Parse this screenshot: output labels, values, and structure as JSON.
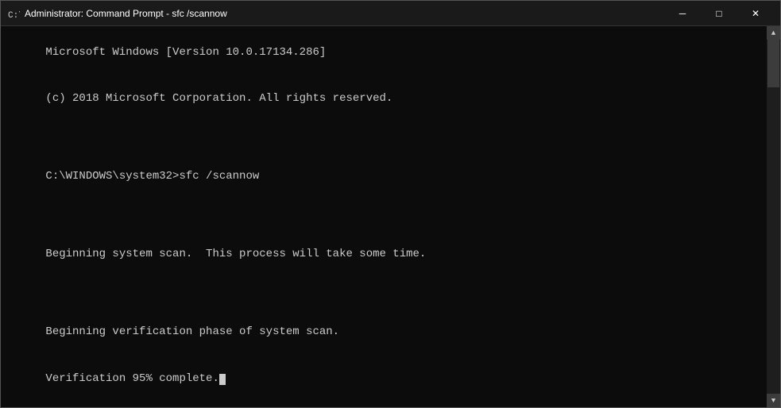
{
  "titlebar": {
    "icon_label": "cmd-icon",
    "title": "Administrator: Command Prompt - sfc /scannow",
    "minimize_label": "─",
    "maximize_label": "□",
    "close_label": "✕"
  },
  "terminal": {
    "line1": "Microsoft Windows [Version 10.0.17134.286]",
    "line2": "(c) 2018 Microsoft Corporation. All rights reserved.",
    "line3": "",
    "line4": "C:\\WINDOWS\\system32>sfc /scannow",
    "line5": "",
    "line6": "Beginning system scan.  This process will take some time.",
    "line7": "",
    "line8": "Beginning verification phase of system scan.",
    "line9": "Verification 95% complete."
  }
}
